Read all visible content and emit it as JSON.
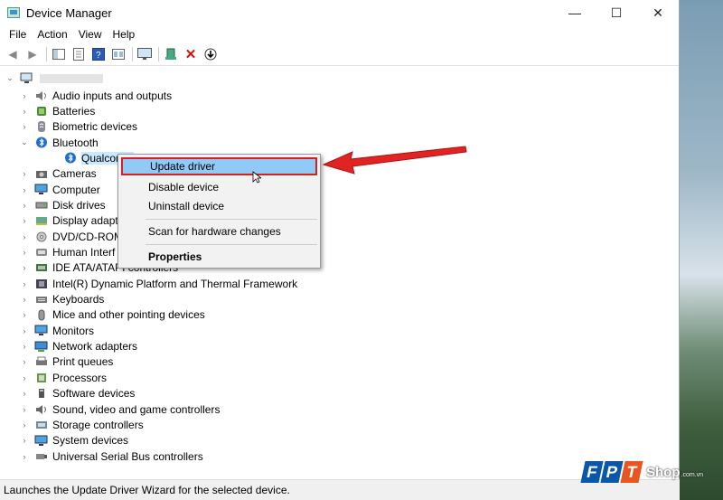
{
  "window": {
    "title": "Device Manager",
    "controls": {
      "minimize": "—",
      "maximize": "☐",
      "close": "✕"
    }
  },
  "menu": [
    "File",
    "Action",
    "View",
    "Help"
  ],
  "tree": {
    "root_label": "",
    "items": [
      {
        "label": "Audio inputs and outputs",
        "icon": "speaker-icon"
      },
      {
        "label": "Batteries",
        "icon": "battery-icon"
      },
      {
        "label": "Biometric devices",
        "icon": "fingerprint-icon"
      },
      {
        "label": "Bluetooth",
        "icon": "bluetooth-icon",
        "expanded": true
      },
      {
        "label": "Qualcomm",
        "icon": "bluetooth-icon",
        "child": true
      },
      {
        "label": "Cameras",
        "icon": "camera-icon"
      },
      {
        "label": "Computer",
        "icon": "monitor-icon"
      },
      {
        "label": "Disk drives",
        "icon": "disk-icon"
      },
      {
        "label": "Display adapt",
        "icon": "display-adapter-icon"
      },
      {
        "label": "DVD/CD-ROM",
        "icon": "dvd-icon"
      },
      {
        "label": "Human Interf",
        "icon": "hid-icon"
      },
      {
        "label": "IDE ATA/ATAPI controllers",
        "icon": "ide-controller-icon"
      },
      {
        "label": "Intel(R) Dynamic Platform and Thermal Framework",
        "icon": "chip-icon"
      },
      {
        "label": "Keyboards",
        "icon": "keyboard-icon"
      },
      {
        "label": "Mice and other pointing devices",
        "icon": "mouse-icon"
      },
      {
        "label": "Monitors",
        "icon": "monitor-icon"
      },
      {
        "label": "Network adapters",
        "icon": "network-icon"
      },
      {
        "label": "Print queues",
        "icon": "printer-icon"
      },
      {
        "label": "Processors",
        "icon": "processor-icon"
      },
      {
        "label": "Software devices",
        "icon": "software-device-icon"
      },
      {
        "label": "Sound, video and game controllers",
        "icon": "sound-icon"
      },
      {
        "label": "Storage controllers",
        "icon": "storage-icon"
      },
      {
        "label": "System devices",
        "icon": "system-icon"
      },
      {
        "label": "Universal Serial Bus controllers",
        "icon": "usb-icon"
      }
    ]
  },
  "context_menu": {
    "update": "Update driver",
    "disable": "Disable device",
    "uninstall": "Uninstall device",
    "scan": "Scan for hardware changes",
    "properties": "Properties"
  },
  "status_bar": "Launches the Update Driver Wizard for the selected device.",
  "watermark": {
    "f": "F",
    "p": "P",
    "t": "T",
    "shop": "Shop",
    "domain": ".com.vn"
  },
  "colors": {
    "highlight": "#91c9f7",
    "annotation": "#d62020"
  }
}
